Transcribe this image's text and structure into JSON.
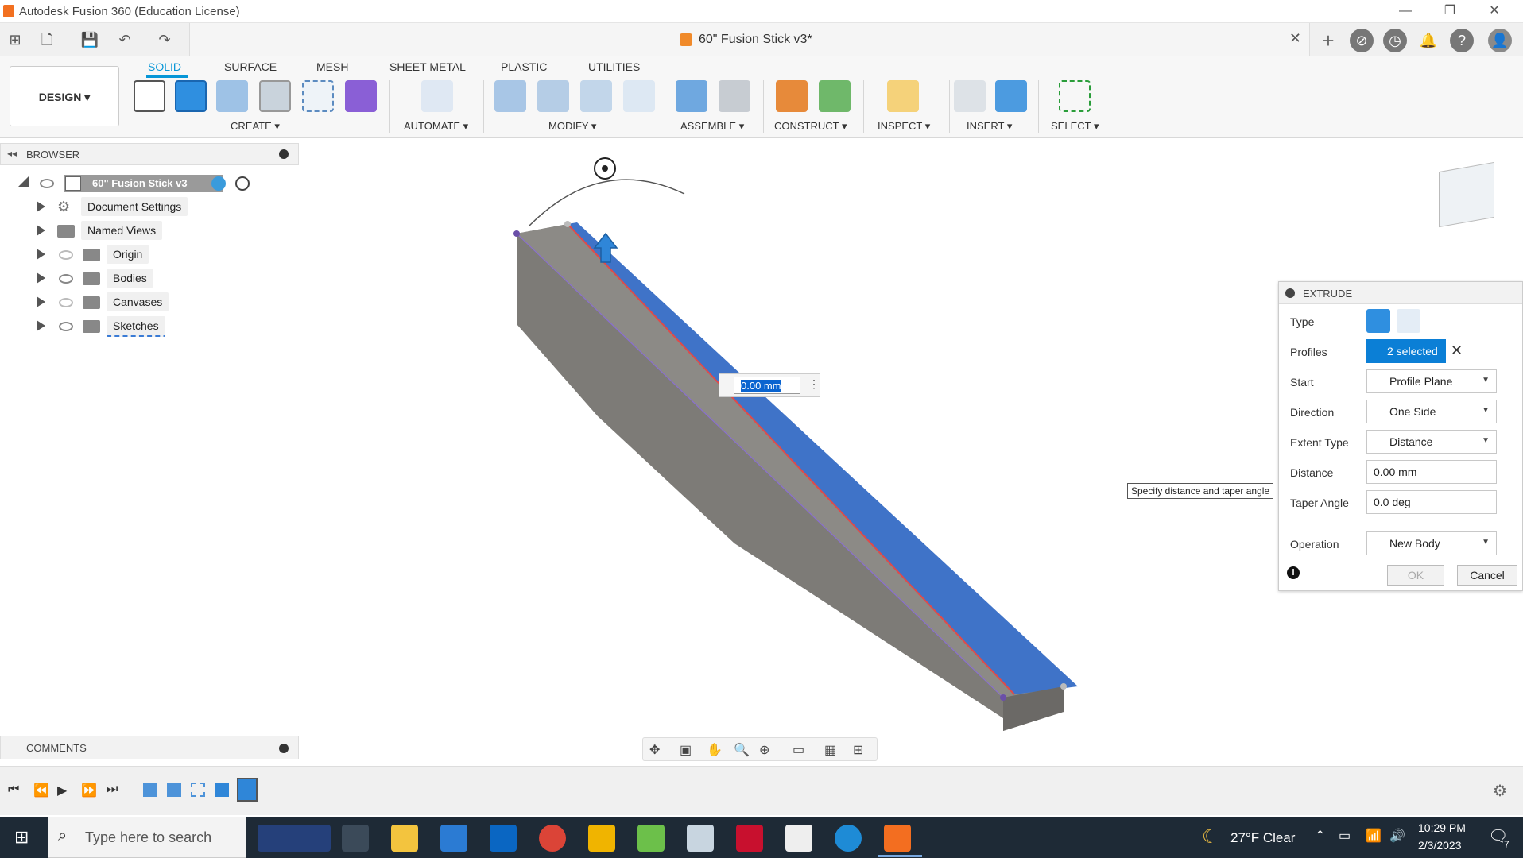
{
  "window": {
    "title": "Autodesk Fusion 360 (Education License)",
    "doc_tab": "60\" Fusion Stick v3*"
  },
  "ribbon": {
    "design_label": "DESIGN ▾",
    "tabs": [
      "SOLID",
      "SURFACE",
      "MESH",
      "SHEET METAL",
      "PLASTIC",
      "UTILITIES"
    ],
    "groups": [
      "CREATE ▾",
      "AUTOMATE ▾",
      "MODIFY ▾",
      "ASSEMBLE ▾",
      "CONSTRUCT ▾",
      "INSPECT ▾",
      "INSERT ▾",
      "SELECT ▾"
    ]
  },
  "browser": {
    "title": "BROWSER",
    "root": "60\" Fusion Stick v3",
    "items": [
      "Document Settings",
      "Named Views",
      "Origin",
      "Bodies",
      "Canvases",
      "Sketches"
    ]
  },
  "comments": {
    "title": "COMMENTS"
  },
  "viewport": {
    "distance_input": "0.00 mm",
    "tooltip": "Specify distance and taper angle"
  },
  "extrude": {
    "title": "EXTRUDE",
    "labels": {
      "type": "Type",
      "profiles": "Profiles",
      "start": "Start",
      "direction": "Direction",
      "extent_type": "Extent Type",
      "distance": "Distance",
      "taper": "Taper Angle",
      "operation": "Operation"
    },
    "values": {
      "profiles": "2 selected",
      "start": "Profile Plane",
      "direction": "One Side",
      "extent_type": "Distance",
      "distance": "0.00 mm",
      "taper": "0.0 deg",
      "operation": "New Body"
    },
    "ok": "OK",
    "cancel": "Cancel"
  },
  "taskbar": {
    "search_placeholder": "Type here to search",
    "weather": "27°F  Clear",
    "time": "10:29 PM",
    "date": "2/3/2023",
    "notif_count": "7"
  },
  "colors": {
    "accent": "#0696d7",
    "body_gray": "#7d7b77",
    "face_blue": "#3f73c8"
  }
}
